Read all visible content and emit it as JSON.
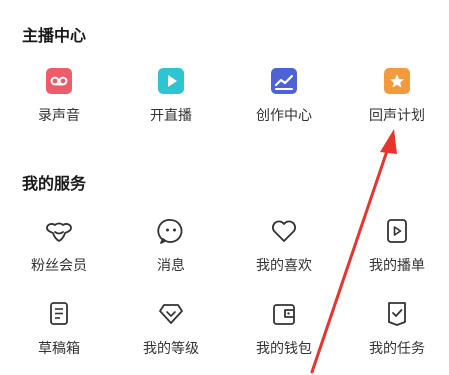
{
  "sections": [
    {
      "title": "主播中心",
      "items": [
        {
          "label": "录声音",
          "icon": "record-voice-icon",
          "color": "#ee5b6a"
        },
        {
          "label": "开直播",
          "icon": "live-stream-icon",
          "color": "#2ec5d2"
        },
        {
          "label": "创作中心",
          "icon": "creator-center-icon",
          "color": "#4e62d8"
        },
        {
          "label": "回声计划",
          "icon": "echo-plan-icon",
          "color": "#f39a3c"
        }
      ]
    },
    {
      "title": "我的服务",
      "items": [
        {
          "label": "粉丝会员",
          "icon": "fan-member-icon"
        },
        {
          "label": "消息",
          "icon": "message-icon"
        },
        {
          "label": "我的喜欢",
          "icon": "heart-icon"
        },
        {
          "label": "我的播单",
          "icon": "playlist-icon"
        },
        {
          "label": "草稿箱",
          "icon": "draft-icon"
        },
        {
          "label": "我的等级",
          "icon": "level-icon"
        },
        {
          "label": "我的钱包",
          "icon": "wallet-icon"
        },
        {
          "label": "我的任务",
          "icon": "task-icon"
        }
      ]
    }
  ],
  "annotation": {
    "arrow_color": "#e8342a"
  }
}
